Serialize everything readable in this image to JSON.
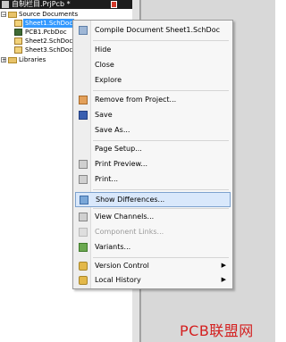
{
  "tree": {
    "project_title": "自制栏目.PrjPcb *",
    "items": [
      {
        "label": "Source Documents",
        "expander": "−"
      },
      {
        "label": "Sheet1.SchDoc"
      },
      {
        "label": "PCB1.PcbDoc"
      },
      {
        "label": "Sheet2.SchDoc"
      },
      {
        "label": "Sheet3.SchDoc"
      },
      {
        "label": "Libraries",
        "expander": "+"
      }
    ]
  },
  "menu": {
    "items": [
      {
        "label": "Compile Document Sheet1.SchDoc",
        "icon": "compile-icon"
      },
      {
        "label": "Hide"
      },
      {
        "label": "Close"
      },
      {
        "label": "Explore"
      },
      {
        "label": "Remove from Project...",
        "icon": "remove-icon"
      },
      {
        "label": "Save",
        "icon": "save-icon"
      },
      {
        "label": "Save As..."
      },
      {
        "label": "Page Setup..."
      },
      {
        "label": "Print Preview...",
        "icon": "print-preview-icon"
      },
      {
        "label": "Print...",
        "icon": "print-icon"
      },
      {
        "label": "Show Differences...",
        "icon": "show-differences-icon"
      },
      {
        "label": "View Channels...",
        "icon": "view-channels-icon"
      },
      {
        "label": "Component Links...",
        "icon": "component-links-icon"
      },
      {
        "label": "Variants...",
        "icon": "variants-icon"
      },
      {
        "label": "Version Control",
        "icon": "version-control-icon",
        "arrow": "▶"
      },
      {
        "label": "Local History",
        "icon": "local-history-icon",
        "arrow": "▶"
      }
    ]
  },
  "watermark": "PCB联盟网"
}
